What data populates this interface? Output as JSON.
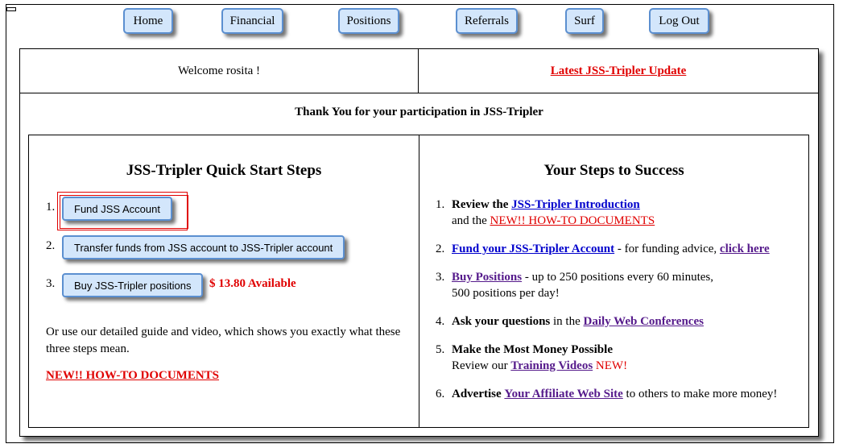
{
  "nav": {
    "home": "Home",
    "financial": "Financial",
    "positions": "Positions",
    "referrals": "Referrals",
    "surf": "Surf",
    "logout": "Log Out"
  },
  "header": {
    "welcome": "Welcome rosita !",
    "update_link": "Latest JSS-Tripler Update",
    "thanks": "Thank You for your participation in JSS-Tripler"
  },
  "quick_start": {
    "title": "JSS-Tripler Quick Start Steps",
    "steps": [
      {
        "num": "1.",
        "label": "Fund JSS Account"
      },
      {
        "num": "2.",
        "label": "Transfer funds from JSS account to JSS-Tripler account"
      },
      {
        "num": "3.",
        "label": "Buy JSS-Tripler positions"
      }
    ],
    "available": "$ 13.80 Available",
    "guide_text": "Or use our detailed guide and video, which shows you exactly what these three steps mean.",
    "howto_link": "NEW!! HOW-TO DOCUMENTS"
  },
  "success": {
    "title": "Your Steps to Success",
    "items": [
      {
        "num": "1.",
        "pre": "Review the ",
        "link": "JSS-Tripler Introduction",
        "line2_pre": "and the ",
        "line2_link": "NEW!! HOW-TO DOCUMENTS"
      },
      {
        "num": "2.",
        "link": "Fund your JSS-Tripler Account",
        "mid": " - for funding advice, ",
        "link2": "click here"
      },
      {
        "num": "3.",
        "link": "Buy Positions",
        "mid": " - up to 250 positions every 60 minutes,",
        "line2": "500 positions per day!"
      },
      {
        "num": "4.",
        "pre": "Ask your questions",
        "mid": " in the ",
        "link": "Daily Web Conferences"
      },
      {
        "num": "5.",
        "pre": "Make the Most Money Possible",
        "line2_pre": "Review our ",
        "line2_link": "Training Videos",
        "line2_new": " NEW!"
      },
      {
        "num": "6.",
        "pre": "Advertise",
        "link": "Your Affiliate Web Site",
        "post": " to others to make more money!"
      }
    ]
  }
}
